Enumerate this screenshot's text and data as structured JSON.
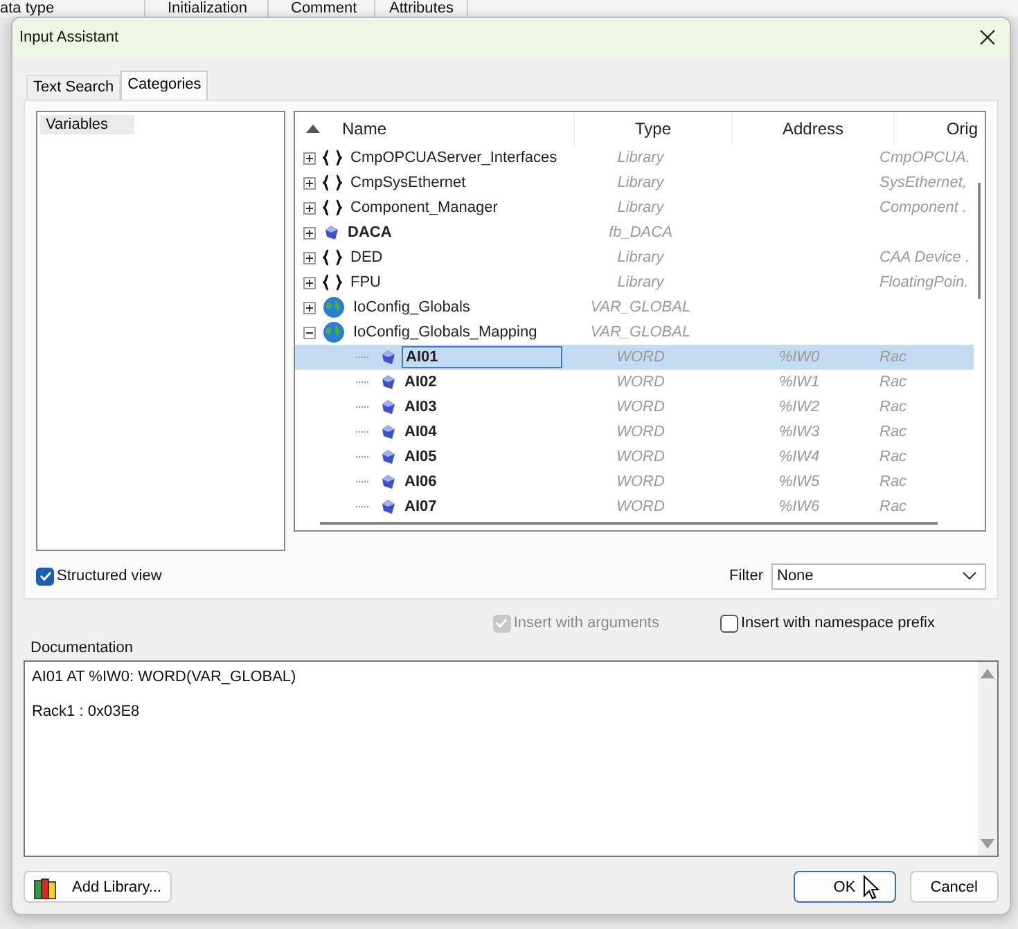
{
  "background_columns": [
    "ata type",
    "Initialization",
    "Comment",
    "Attributes"
  ],
  "window": {
    "title": "Input Assistant"
  },
  "tabs": [
    {
      "label": "Text Search",
      "selected": false
    },
    {
      "label": "Categories",
      "selected": true
    }
  ],
  "categories": [
    {
      "label": "Variables",
      "selected": true
    }
  ],
  "tree": {
    "columns": [
      "Name",
      "Type",
      "Address",
      "Orig"
    ],
    "items": [
      {
        "kind": "library",
        "name": "CmpOPCUAServer_Interfaces",
        "type": "Library",
        "origin": "CmpOPCUA.",
        "expanded": false,
        "selected": false
      },
      {
        "kind": "library",
        "name": "CmpSysEthernet",
        "type": "Library",
        "origin": "SysEthernet,",
        "expanded": false,
        "selected": false
      },
      {
        "kind": "library",
        "name": "Component_Manager",
        "type": "Library",
        "origin": "Component .",
        "expanded": false,
        "selected": false
      },
      {
        "kind": "block",
        "name": "DACA",
        "type": "fb_DACA",
        "expanded": false,
        "selected": false
      },
      {
        "kind": "library",
        "name": "DED",
        "type": "Library",
        "origin": "CAA Device .",
        "expanded": false,
        "selected": false
      },
      {
        "kind": "library",
        "name": "FPU",
        "type": "Library",
        "origin": "FloatingPoin.",
        "expanded": false,
        "selected": false
      },
      {
        "kind": "globals",
        "name": "IoConfig_Globals",
        "type": "VAR_GLOBAL",
        "expanded": false,
        "selected": false
      },
      {
        "kind": "globals",
        "name": "IoConfig_Globals_Mapping",
        "type": "VAR_GLOBAL",
        "expanded": true,
        "selected": false,
        "children": [
          {
            "kind": "variable",
            "name": "AI01",
            "type": "WORD",
            "address": "%IW0",
            "origin": "Rac",
            "selected": true
          },
          {
            "kind": "variable",
            "name": "AI02",
            "type": "WORD",
            "address": "%IW1",
            "origin": "Rac",
            "selected": false
          },
          {
            "kind": "variable",
            "name": "AI03",
            "type": "WORD",
            "address": "%IW2",
            "origin": "Rac",
            "selected": false
          },
          {
            "kind": "variable",
            "name": "AI04",
            "type": "WORD",
            "address": "%IW3",
            "origin": "Rac",
            "selected": false
          },
          {
            "kind": "variable",
            "name": "AI05",
            "type": "WORD",
            "address": "%IW4",
            "origin": "Rac",
            "selected": false
          },
          {
            "kind": "variable",
            "name": "AI06",
            "type": "WORD",
            "address": "%IW5",
            "origin": "Rac",
            "selected": false
          },
          {
            "kind": "variable",
            "name": "AI07",
            "type": "WORD",
            "address": "%IW6",
            "origin": "Rac",
            "selected": false
          }
        ]
      }
    ]
  },
  "structured_view": {
    "label": "Structured view",
    "checked": true
  },
  "filter": {
    "label": "Filter",
    "value": "None"
  },
  "insert_with_arguments": {
    "label": "Insert with arguments",
    "checked": true,
    "disabled": true
  },
  "insert_with_namespace_prefix": {
    "label": "Insert with namespace prefix",
    "checked": false,
    "disabled": false
  },
  "documentation": {
    "label": "Documentation",
    "lines": [
      "AI01 AT %IW0: WORD(VAR_GLOBAL)",
      "Rack1 : 0x03E8"
    ]
  },
  "buttons": {
    "add_library": "Add Library...",
    "ok": "OK",
    "cancel": "Cancel"
  }
}
